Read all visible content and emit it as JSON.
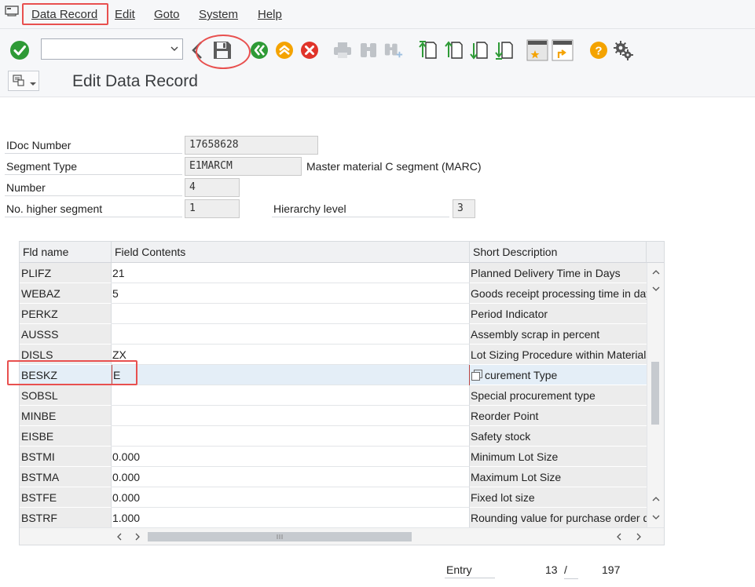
{
  "menu": {
    "items": [
      {
        "label": "Data Record"
      },
      {
        "label": "Edit"
      },
      {
        "label": "Goto"
      },
      {
        "label": "System"
      },
      {
        "label": "Help"
      }
    ]
  },
  "toolbar": {
    "command_field_value": "",
    "icons": [
      "enter-check-icon",
      "back-icon",
      "save-icon",
      "exit-icon",
      "cancel-icon",
      "print-icon",
      "find-icon",
      "find-next-icon",
      "first-page-icon",
      "previous-page-icon",
      "next-page-icon",
      "last-page-icon",
      "create-session-icon",
      "shortcut-icon",
      "help-icon",
      "customize-layout-icon"
    ],
    "accent_green": "#2e9a36",
    "accent_orange": "#f4a300",
    "accent_red": "#e0342a"
  },
  "header": {
    "title": "Edit Data Record"
  },
  "form": {
    "idoc_number_label": "IDoc Number",
    "idoc_number": "17658628",
    "segment_type_label": "Segment Type",
    "segment_type": "E1MARCM",
    "segment_desc": "Master material C segment (MARC)",
    "number_label": "Number",
    "number": "4",
    "higher_segment_label": "No. higher segment",
    "higher_segment": "1",
    "hierarchy_label": "Hierarchy level",
    "hierarchy_level": "3"
  },
  "table": {
    "columns": [
      "Fld name",
      "Field Contents",
      "Short Description"
    ],
    "rows": [
      {
        "name": "PLIFZ",
        "value": "21",
        "desc": "Planned Delivery Time in Days"
      },
      {
        "name": "WEBAZ",
        "value": "5",
        "desc": "Goods receipt processing time in days"
      },
      {
        "name": "PERKZ",
        "value": "",
        "desc": "Period Indicator"
      },
      {
        "name": "AUSSS",
        "value": "",
        "desc": "Assembly scrap in percent"
      },
      {
        "name": "DISLS",
        "value": "ZX",
        "desc": "Lot Sizing Procedure within Materials Planning"
      },
      {
        "name": "BESKZ",
        "value": "E",
        "desc": "curement Type"
      },
      {
        "name": "SOBSL",
        "value": "",
        "desc": "Special procurement type"
      },
      {
        "name": "MINBE",
        "value": "",
        "desc": "Reorder Point"
      },
      {
        "name": "EISBE",
        "value": "",
        "desc": "Safety stock"
      },
      {
        "name": "BSTMI",
        "value": "0.000",
        "desc": "Minimum Lot Size"
      },
      {
        "name": "BSTMA",
        "value": "0.000",
        "desc": "Maximum Lot Size"
      },
      {
        "name": "BSTFE",
        "value": "0.000",
        "desc": "Fixed lot size"
      },
      {
        "name": "BSTRF",
        "value": "1.000",
        "desc": "Rounding value for purchase order quantity"
      }
    ]
  },
  "footer": {
    "entry_label": "Entry",
    "entry_current": "13",
    "entry_separator": "/",
    "entry_total": "197"
  }
}
